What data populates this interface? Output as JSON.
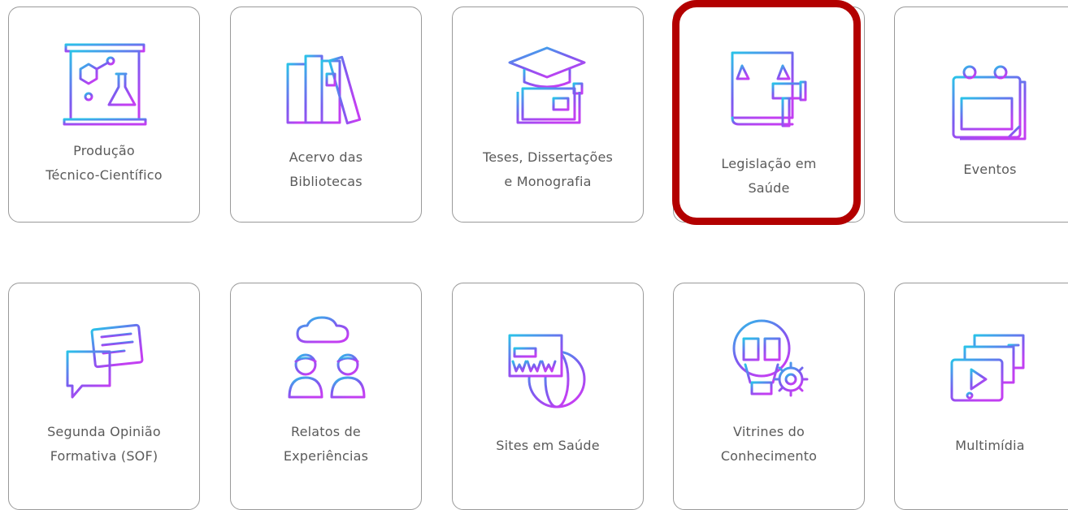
{
  "highlight_color": "#b30000",
  "icon_gradient": [
    "#29c3e8",
    "#7a5cf0",
    "#c23ff2"
  ],
  "categories": [
    {
      "line1": "Produção",
      "line2": "Técnico-Científico",
      "icon": "lab-presentation-icon"
    },
    {
      "line1": "Acervo das",
      "line2": "Bibliotecas",
      "icon": "books-icon"
    },
    {
      "line1": "Teses, Dissertações",
      "line2": "e Monografia",
      "icon": "graduation-cap-book-icon"
    },
    {
      "line1": "Legislação em",
      "line2": "Saúde",
      "icon": "law-scale-gavel-icon"
    },
    {
      "line1": "Eventos",
      "line2": "",
      "icon": "calendar-icon"
    },
    {
      "line1": "Segunda Opinião",
      "line2": "Formativa (SOF)",
      "icon": "chat-bubbles-icon"
    },
    {
      "line1": "Relatos de",
      "line2": "Experiências",
      "icon": "people-talking-icon"
    },
    {
      "line1": "Sites em Saúde",
      "line2": "",
      "icon": "www-globe-icon"
    },
    {
      "line1": "Vitrines do",
      "line2": "Conhecimento",
      "icon": "lightbulb-gear-icon"
    },
    {
      "line1": "Multimídia",
      "line2": "",
      "icon": "video-media-icon"
    }
  ]
}
